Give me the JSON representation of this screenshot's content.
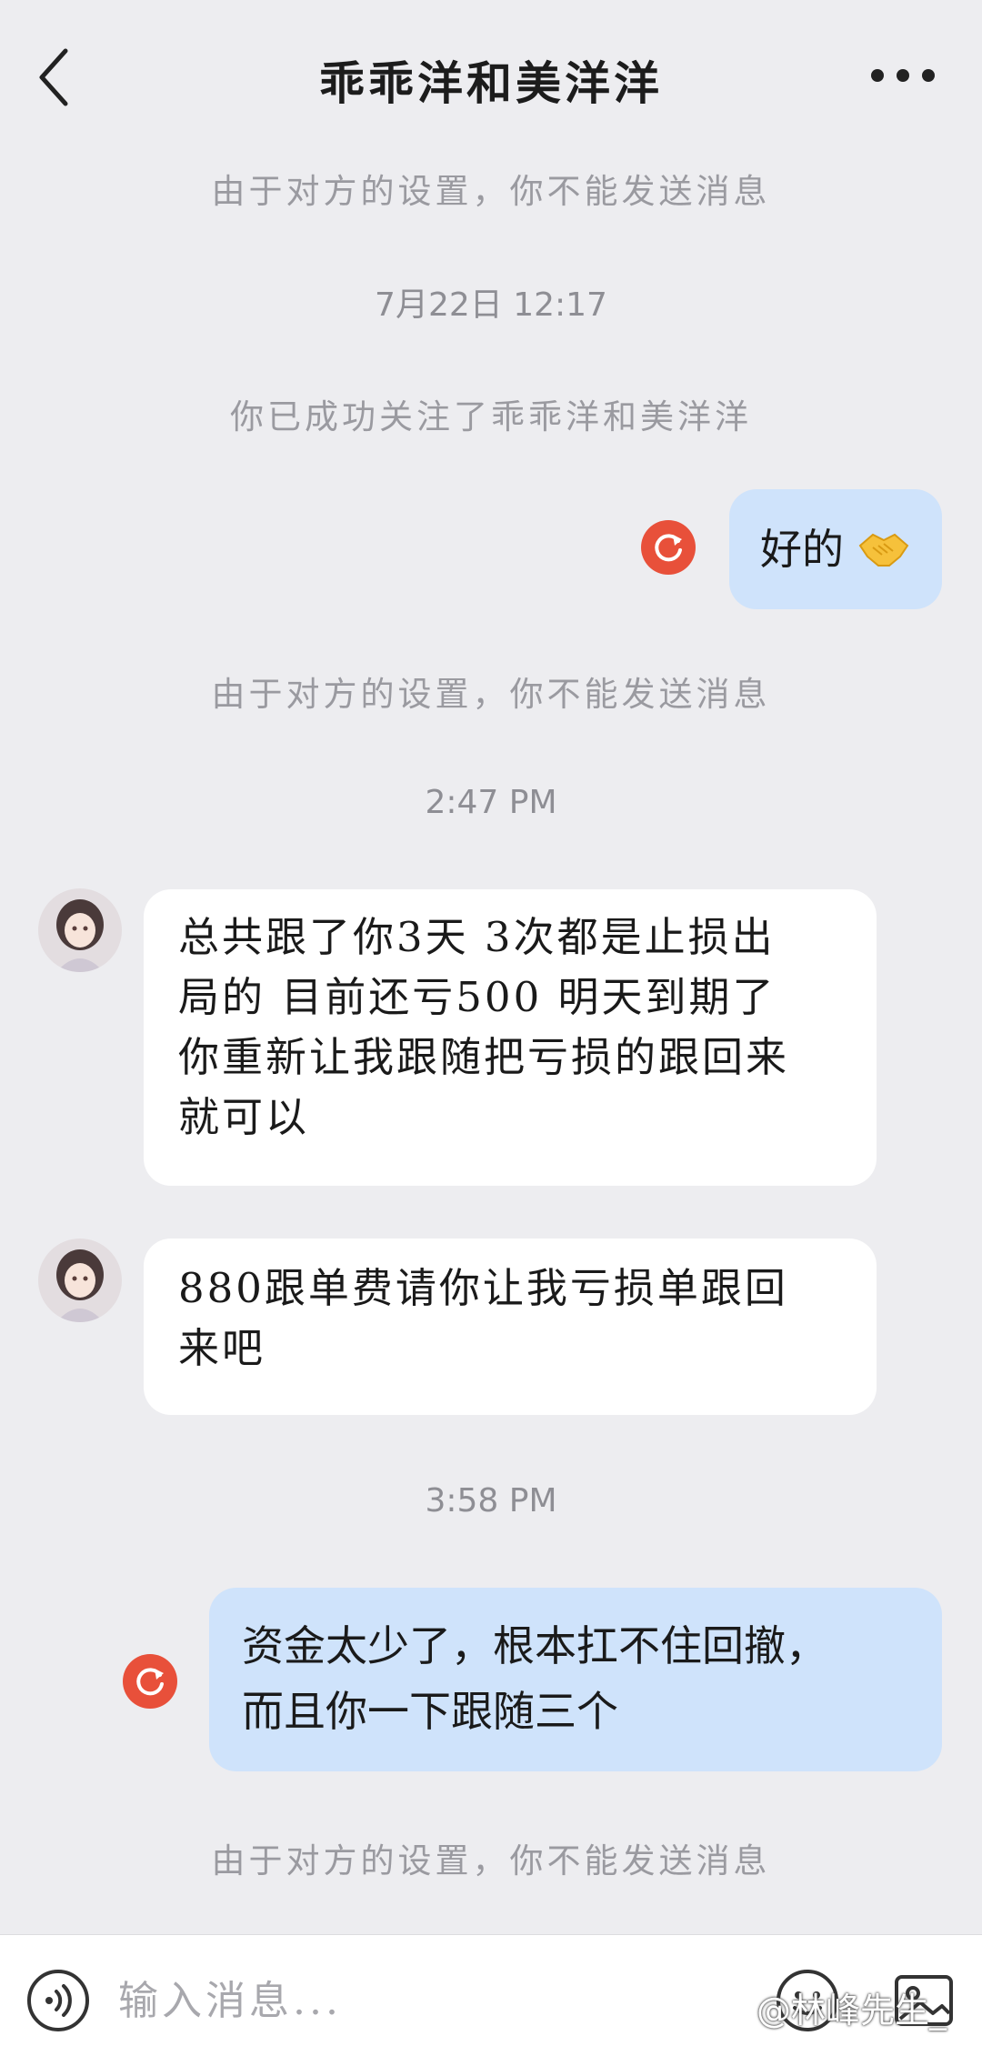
{
  "header": {
    "title": "乖乖洋和美洋洋"
  },
  "notices": {
    "blocked_1": "由于对方的设置，你不能发送消息",
    "followed": "你已成功关注了乖乖洋和美洋洋",
    "blocked_2": "由于对方的设置，你不能发送消息",
    "blocked_3": "由于对方的设置，你不能发送消息"
  },
  "timestamps": {
    "t1": "7月22日  12:17",
    "t2": "2:47 PM",
    "t3": "3:58 PM"
  },
  "messages": {
    "m1": {
      "side": "right",
      "text": "好的",
      "emoji": "handshake"
    },
    "m2": {
      "side": "left",
      "lines": [
        "总共跟了你3天 3次都是止损出",
        "局的 目前还亏500  明天到期了",
        "你重新让我跟随把亏损的跟回来",
        "就可以"
      ]
    },
    "m3": {
      "side": "left",
      "lines": [
        "880跟单费请你让我亏损单跟回",
        "来吧"
      ]
    },
    "m4": {
      "side": "right",
      "lines": [
        "资金太少了，根本扛不住回撤，",
        "而且你一下跟随三个"
      ]
    }
  },
  "input": {
    "placeholder": "输入消息..."
  },
  "watermark": "@林峰先生_",
  "colors": {
    "background": "#ededf0",
    "bubble_right": "#cfe3fb",
    "bubble_left": "#ffffff",
    "resend_red": "#e8503a"
  },
  "icons": [
    "back-icon",
    "more-icon",
    "resend-icon",
    "voice-icon",
    "emoji-icon",
    "image-icon",
    "handshake-emoji"
  ]
}
